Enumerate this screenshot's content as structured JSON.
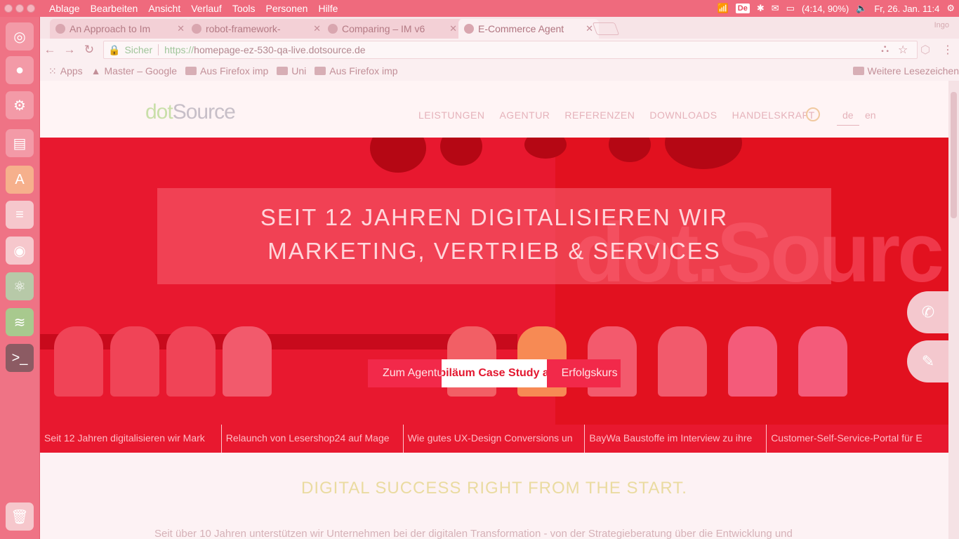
{
  "menubar": {
    "items": [
      "Ablage",
      "Bearbeiten",
      "Ansicht",
      "Verlauf",
      "Tools",
      "Personen",
      "Hilfe"
    ],
    "keyboard_layout": "De",
    "battery": "(4:14, 90%)",
    "datetime": "Fr, 26. Jan. 11:4"
  },
  "launcher": {
    "icons": [
      "ubuntu-dash-icon",
      "firefox-icon",
      "settings-icon",
      "files-icon",
      "software-center-icon",
      "text-editor-icon",
      "chrome-icon",
      "atom-icon",
      "spotify-icon",
      "terminal-icon",
      "trash-icon"
    ]
  },
  "tabs": [
    {
      "title": "An Approach to Im"
    },
    {
      "title": "robot-framework-"
    },
    {
      "title": "Comparing – IM v6"
    },
    {
      "title": "E-Commerce Agent"
    }
  ],
  "profile_name": "Ingo",
  "omnibox": {
    "secure_label": "Sicher",
    "url_scheme": "https://",
    "url_rest": "homepage-ez-530-qa-live.dotsource.de"
  },
  "bookmarks": {
    "items": [
      "Apps",
      "Master – Google",
      "Aus Firefox imp",
      "Uni",
      "Aus Firefox imp"
    ],
    "other": "Weitere Lesezeichen"
  },
  "site": {
    "logo_dot": "dot",
    "logo_source": "Source",
    "nav": [
      "LEISTUNGEN",
      "AGENTUR",
      "REFERENZEN",
      "DOWNLOADS",
      "HANDELSKRAFT"
    ],
    "lang_de": "de",
    "lang_en": "en",
    "hero": {
      "headline_1": "SEIT 12 JAHREN DIGITALISIEREN WIR",
      "headline_2": "MARKETING, VERTRIEB & SERVICES",
      "cta_text": "Zum Agentur",
      "cta_active": "jubiläum Case Study auf",
      "cta_end": "Erfolgskurs"
    },
    "slides": [
      "Seit 12 Jahren digitalisieren wir Mark",
      "Relaunch von Lesershop24 auf Mage",
      "Wie gutes UX-Design Conversions un",
      "BayWa Baustoffe im Interview zu ihre",
      "Customer-Self-Service-Portal für E"
    ],
    "section_title": "DIGITAL SUCCESS RIGHT FROM THE START.",
    "section_text": "Seit über 10 Jahren unterstützen wir Unternehmen bei der digitalen Transformation - von der Strategieberatung über die Entwicklung und"
  },
  "colors": {
    "hero_red": "#e8182f",
    "accent_green": "#c9dfa9"
  }
}
